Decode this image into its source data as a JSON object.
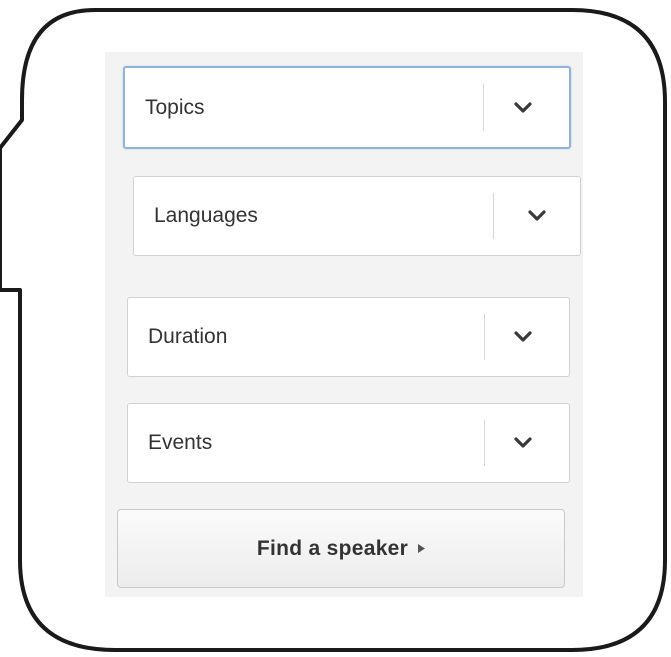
{
  "filters": {
    "topics": {
      "label": "Topics",
      "icon": "chevron-down-icon"
    },
    "languages": {
      "label": "Languages",
      "icon": "chevron-down-icon"
    },
    "duration": {
      "label": "Duration",
      "icon": "chevron-down-icon"
    },
    "events": {
      "label": "Events",
      "icon": "chevron-down-icon"
    }
  },
  "actions": {
    "find_speaker_label": "Find a speaker",
    "find_speaker_icon": "triangle-right-icon"
  },
  "colors": {
    "focus_border": "#8fb3de",
    "text": "#333333",
    "panel_bg": "#f3f3f3"
  }
}
